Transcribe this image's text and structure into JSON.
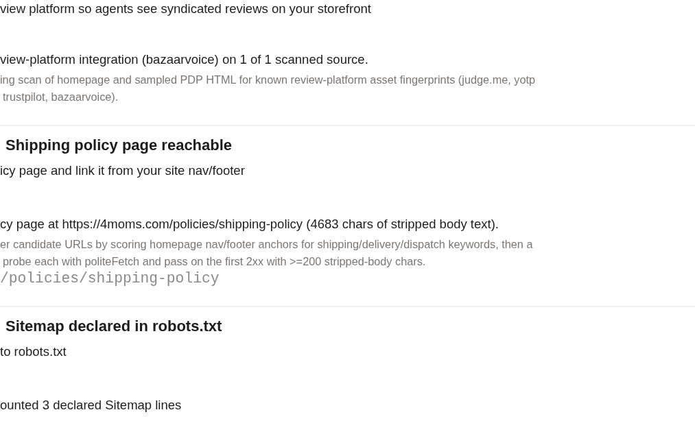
{
  "checks": [
    {
      "fix": "view platform so agents see syndicated reviews on your storefront",
      "result": "view-platform integration (bazaarvoice) on 1 of 1 scanned source.",
      "method": [
        "ing scan of homepage and sampled PDP HTML for known review-platform asset fingerprints (judge.me, yotp",
        "trustpilot, bazaarvoice)."
      ]
    },
    {
      "title": "Shipping policy page reachable",
      "fix": "icy page and link it from your site nav/footer",
      "result": "cy page at https://4moms.com/policies/shipping-policy (4683 chars of stripped body text).",
      "method": [
        "er candidate URLs by scoring homepage nav/footer anchors for shipping/delivery/dispatch keywords, then a",
        "probe each with politeFetch and pass on the first 2xx with >=200 stripped-body chars."
      ],
      "evidence": "/policies/shipping-policy"
    },
    {
      "title": "Sitemap declared in robots.txt",
      "fix": "to robots.txt",
      "result": "ounted 3 declared Sitemap lines"
    }
  ]
}
